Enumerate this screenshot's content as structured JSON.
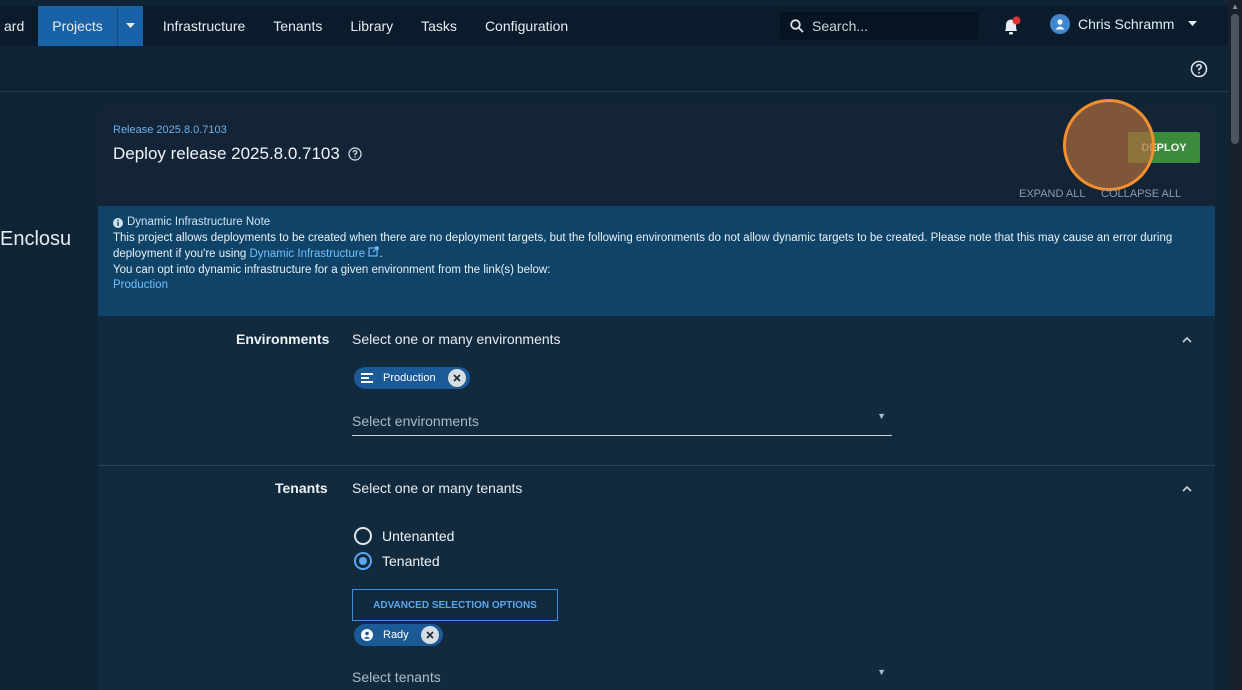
{
  "nav": {
    "items": [
      {
        "label": "ard",
        "active": false
      },
      {
        "label": "Projects",
        "active": true
      },
      {
        "label": "Infrastructure",
        "active": false
      },
      {
        "label": "Tenants",
        "active": false
      },
      {
        "label": "Library",
        "active": false
      },
      {
        "label": "Tasks",
        "active": false
      },
      {
        "label": "Configuration",
        "active": false
      }
    ],
    "search_placeholder": "Search...",
    "user_name": "Chris Schramm"
  },
  "sidebar": {
    "truncated_project": "Enclosu"
  },
  "release": {
    "link_label": "Release 2025.8.0.7103",
    "title": "Deploy release 2025.8.0.7103",
    "deploy_label": "DEPLOY",
    "expand_all": "EXPAND ALL",
    "collapse_all": "COLLAPSE ALL"
  },
  "note": {
    "title": "Dynamic Infrastructure Note",
    "line1": "This project allows deployments to be created when there are no deployment targets, but the following environments do not allow dynamic targets to be created. Please note that this may cause an error during deployment if you're using",
    "link": "Dynamic Infrastructure",
    "line1_end": ".",
    "line2": "You can opt into dynamic infrastructure for a given environment from the link(s) below:",
    "env_link": "Production"
  },
  "environments": {
    "label": "Environments",
    "subtitle": "Select one or many environments",
    "chip": "Production",
    "placeholder": "Select environments"
  },
  "tenants": {
    "label": "Tenants",
    "subtitle": "Select one or many tenants",
    "option_untenanted": "Untenanted",
    "option_tenanted": "Tenanted",
    "advanced_button": "ADVANCED SELECTION OPTIONS",
    "chip": "Rady",
    "placeholder": "Select tenants"
  },
  "colors": {
    "accent": "#1a62a8",
    "deploy": "#3c8b3c",
    "note_bg": "#0f4468",
    "link": "#6fb0ee"
  }
}
